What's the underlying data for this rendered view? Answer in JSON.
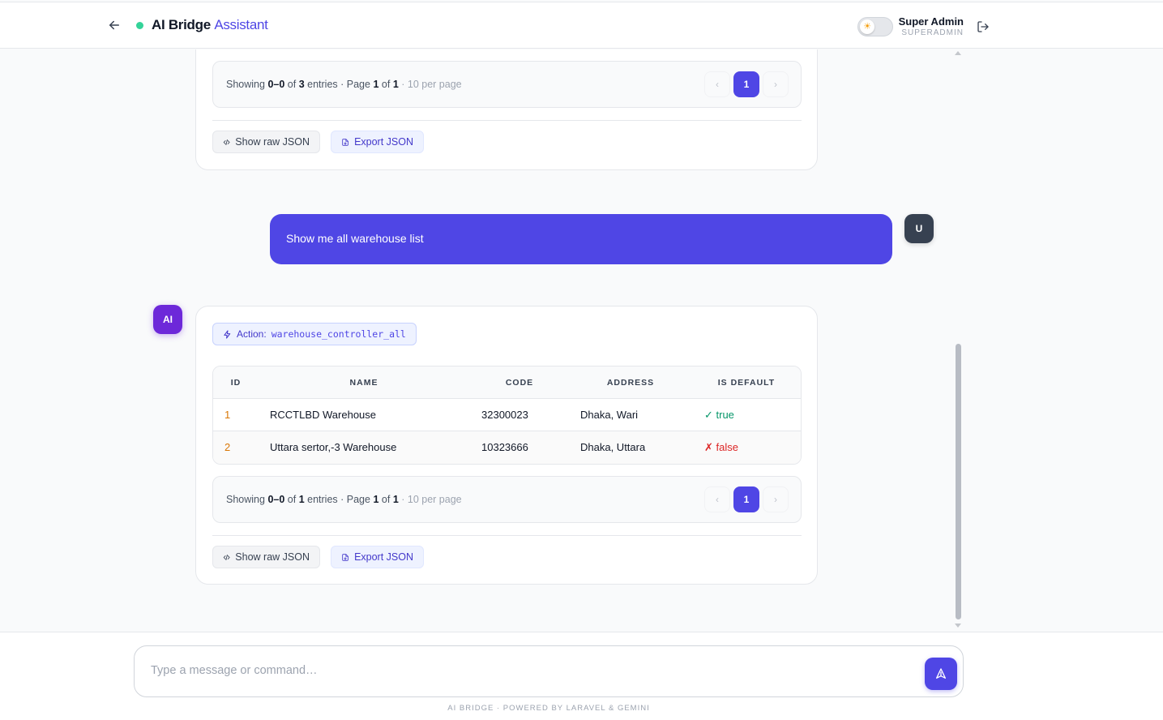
{
  "header": {
    "title_bold": "AI Bridge",
    "title_accent": "Assistant",
    "user_name": "Super Admin",
    "user_role": "SUPERADMIN",
    "status_color": "#34d399",
    "accent_color": "#4f46e5",
    "back_icon": "arrow-left-icon",
    "theme_icon": "sun-icon",
    "logout_icon": "logout-icon"
  },
  "previous_result": {
    "pager": {
      "showing_label": "Showing",
      "range": "0–0",
      "of_label": "of",
      "total": "3",
      "entries_label": "entries · Page",
      "page": "1",
      "page_of_label": "of",
      "pages": "1",
      "per_page": "· 10 per page",
      "current_page": "1"
    },
    "buttons": {
      "raw": "Show raw JSON",
      "export": "Export JSON"
    }
  },
  "user_message": {
    "text": "Show me all warehouse list",
    "avatar": "U"
  },
  "ai_message": {
    "avatar": "AI",
    "action_label": "Action:",
    "action_code": "warehouse_controller_all",
    "table": {
      "columns": [
        "ID",
        "NAME",
        "CODE",
        "ADDRESS",
        "IS DEFAULT"
      ],
      "rows": [
        {
          "id": "1",
          "name": "RCCTLBD Warehouse",
          "code": "32300023",
          "address": "Dhaka, Wari",
          "is_default": "✓ true"
        },
        {
          "id": "2",
          "name": "Uttara sertor,-3 Warehouse",
          "code": "10323666",
          "address": "Dhaka, Uttara",
          "is_default": "✗ false"
        }
      ]
    },
    "pager": {
      "showing_label": "Showing",
      "range": "0–0",
      "of_label": "of",
      "total": "1",
      "entries_label": "entries · Page",
      "page": "1",
      "page_of_label": "of",
      "pages": "1",
      "per_page": "· 10 per page",
      "current_page": "1"
    },
    "buttons": {
      "raw": "Show raw JSON",
      "export": "Export JSON"
    }
  },
  "composer": {
    "placeholder": "Type a message or command…",
    "footer": "AI BRIDGE · POWERED BY LARAVEL & GEMINI"
  }
}
